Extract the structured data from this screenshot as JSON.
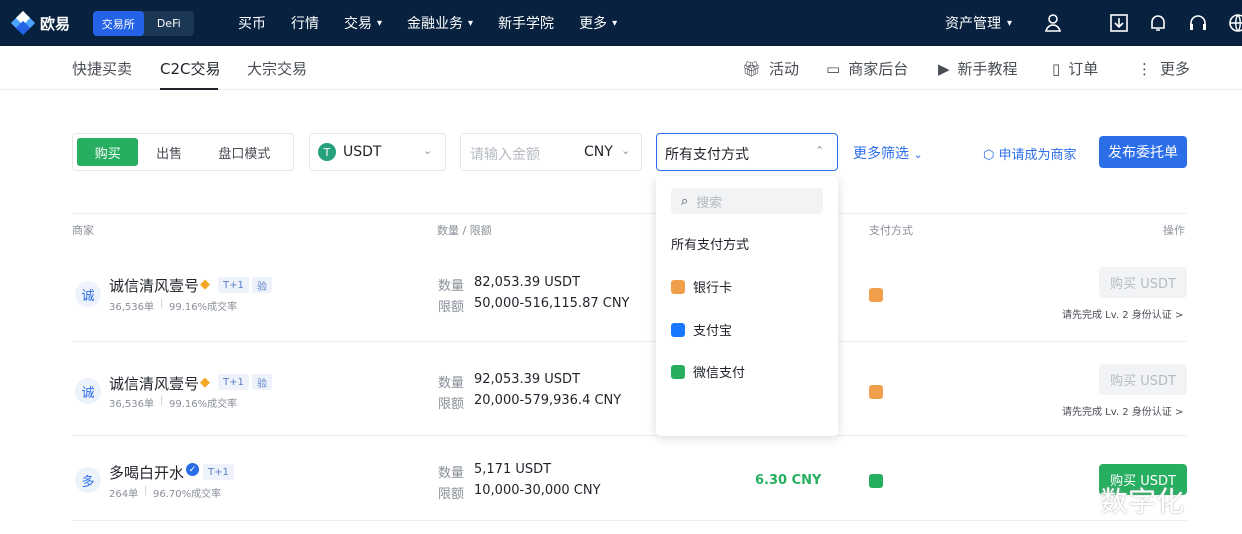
{
  "brand": "欧易",
  "mode": {
    "exchange": "交易所",
    "defi": "DeFi"
  },
  "topnav": [
    "买币",
    "行情",
    "交易",
    "金融业务",
    "新手学院",
    "更多"
  ],
  "topright": {
    "assets": "资产管理"
  },
  "subtabs": [
    "快捷买卖",
    "C2C交易",
    "大宗交易"
  ],
  "subright": [
    "活动",
    "商家后台",
    "新手教程",
    "订单",
    "更多"
  ],
  "filter": {
    "buy": "购买",
    "sell": "出售",
    "book": "盘口模式",
    "coin": "USDT",
    "amount_placeholder": "请输入金额",
    "currency": "CNY",
    "payment": "所有支付方式",
    "more": "更多筛选",
    "apply": "申请成为商家",
    "publish": "发布委托单"
  },
  "dropdown": {
    "search": "搜索",
    "items": [
      "所有支付方式",
      "银行卡",
      "支付宝",
      "微信支付"
    ]
  },
  "columns": {
    "merchant": "商家",
    "amount": "数量 / 限额",
    "payment": "支付方式",
    "action": "操作"
  },
  "rows": [
    {
      "avatar": "诚",
      "name": "诚信清风壹号",
      "tag": "T+1",
      "tag2": "验",
      "orders": "36,536单",
      "rate": "99.16%成交率",
      "qty_label": "数量",
      "qty": "82,053.39 USDT",
      "limit_label": "限额",
      "limit": "50,000-516,115.87 CNY",
      "btn": "购买 USDT",
      "hint": "请先完成 Lv. 2 身份认证 >"
    },
    {
      "avatar": "诚",
      "name": "诚信清风壹号",
      "tag": "T+1",
      "tag2": "验",
      "orders": "36,536单",
      "rate": "99.16%成交率",
      "qty_label": "数量",
      "qty": "92,053.39 USDT",
      "limit_label": "限额",
      "limit": "20,000-579,936.4 CNY",
      "btn": "购买 USDT",
      "hint": "请先完成 Lv. 2 身份认证 >"
    },
    {
      "avatar": "多",
      "name": "多喝白开水",
      "tag": "T+1",
      "orders": "264单",
      "rate": "96.70%成交率",
      "qty_label": "数量",
      "qty": "5,171 USDT",
      "limit_label": "限额",
      "limit": "10,000-30,000 CNY",
      "price": "6.30 CNY",
      "btn": "购买 USDT"
    }
  ],
  "watermark": "数字化"
}
